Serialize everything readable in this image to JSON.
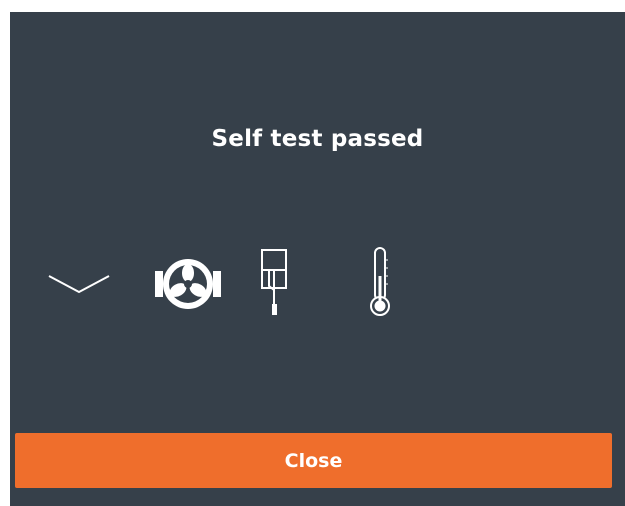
{
  "dialog": {
    "title": "Self test passed",
    "close_label": "Close",
    "icons": [
      "chevron-down-icon",
      "fan-icon",
      "sensor-probe-icon",
      "thermometer-icon"
    ],
    "colors": {
      "background": "#36404a",
      "text": "#ffffff",
      "button": "#ef6e2c"
    }
  }
}
